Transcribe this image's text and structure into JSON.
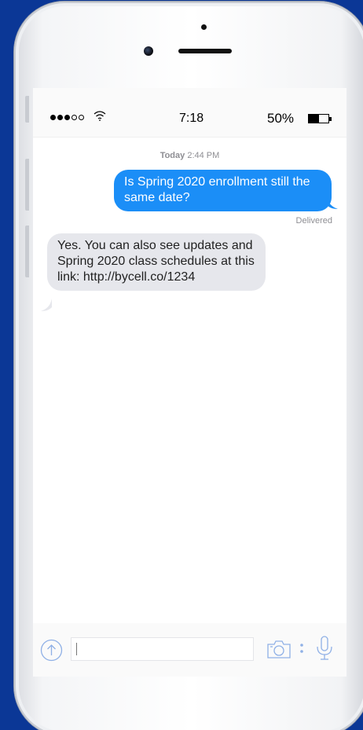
{
  "status_bar": {
    "time": "7:18",
    "battery_percent_text": "50%",
    "battery_level": 0.5,
    "signal_bars_filled": 3,
    "signal_bars_total": 5
  },
  "conversation": {
    "timestamp_day": "Today",
    "timestamp_time": "2:44 PM",
    "messages": [
      {
        "direction": "sent",
        "text": "Is Spring 2020 enrollment still the same date?"
      },
      {
        "direction": "received",
        "text": "Yes. You can also see updates and Spring 2020 class schedules at this link: http://bycell.co/1234"
      }
    ],
    "delivered_label": "Delivered"
  },
  "compose": {
    "input_value": "",
    "input_placeholder": ""
  },
  "colors": {
    "background": "#0b3796",
    "sent_bubble": "#1b8ef7",
    "received_bubble": "#e6e7ec",
    "icon_stroke": "#8fb0e6"
  },
  "icons": {
    "send_up": "arrow-up-circle-icon",
    "camera": "camera-icon",
    "more": "vertical-dots-icon",
    "mic": "microphone-icon",
    "wifi": "wifi-icon",
    "battery": "battery-icon"
  }
}
